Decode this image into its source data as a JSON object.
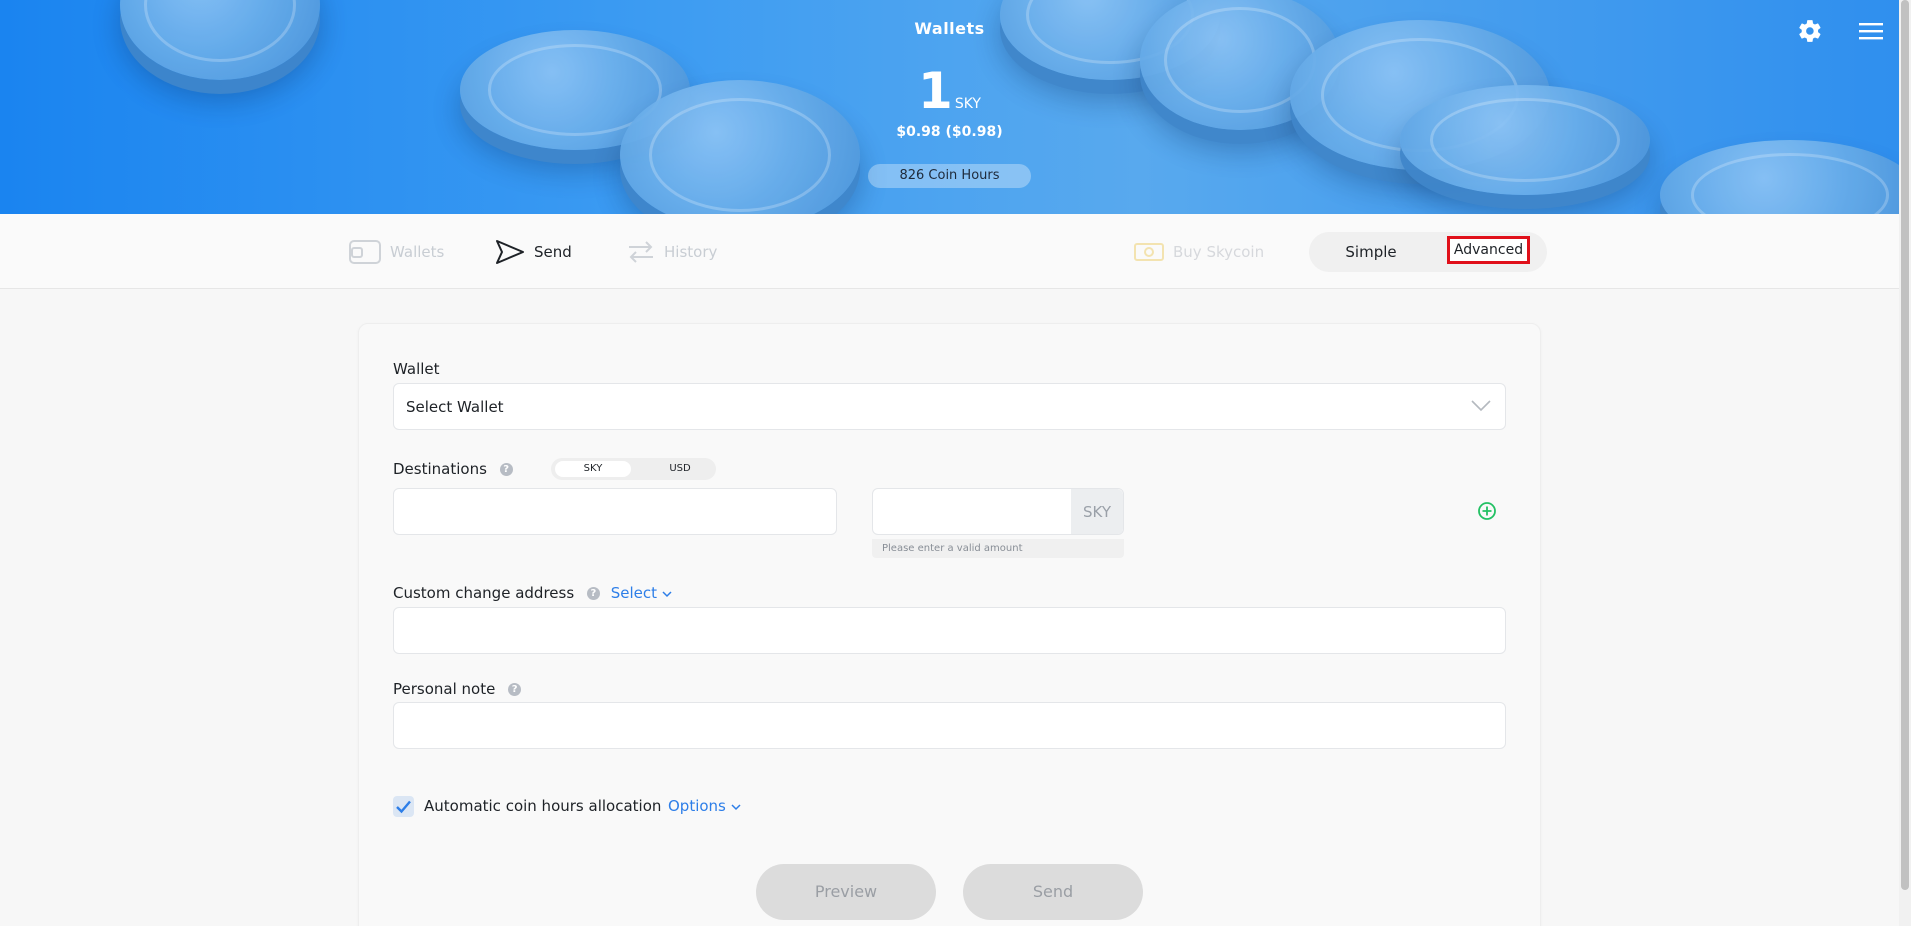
{
  "header": {
    "title": "Wallets",
    "balance_amount": "1",
    "balance_unit": "SKY",
    "usd_value": "$0.98 ($0.98)",
    "coin_hours": "826 Coin Hours",
    "settings_icon": "gear-icon",
    "menu_icon": "hamburger-menu-icon"
  },
  "nav": {
    "items": [
      {
        "label": "Wallets",
        "icon": "wallet-icon"
      },
      {
        "label": "Send",
        "icon": "send-icon"
      },
      {
        "label": "History",
        "icon": "transfer-arrows-icon"
      }
    ],
    "buy_label": "Buy Skycoin",
    "mode_simple": "Simple",
    "mode_advanced": "Advanced"
  },
  "form": {
    "wallet_label": "Wallet",
    "wallet_select": "Select Wallet",
    "destinations_label": "Destinations",
    "unit_sky": "SKY",
    "unit_usd": "USD",
    "amount_suffix": "SKY",
    "amount_hint": "Please enter a valid amount",
    "change_label": "Custom change address",
    "change_select": "Select",
    "note_label": "Personal note",
    "auto_hours_label": "Automatic coin hours allocation",
    "options_label": "Options",
    "auto_hours_checked": true
  },
  "actions": {
    "preview": "Preview",
    "send": "Send"
  },
  "colors": {
    "accent": "#2d7ee8",
    "add_destination": "#23c164",
    "highlight_border": "#e0101a"
  }
}
